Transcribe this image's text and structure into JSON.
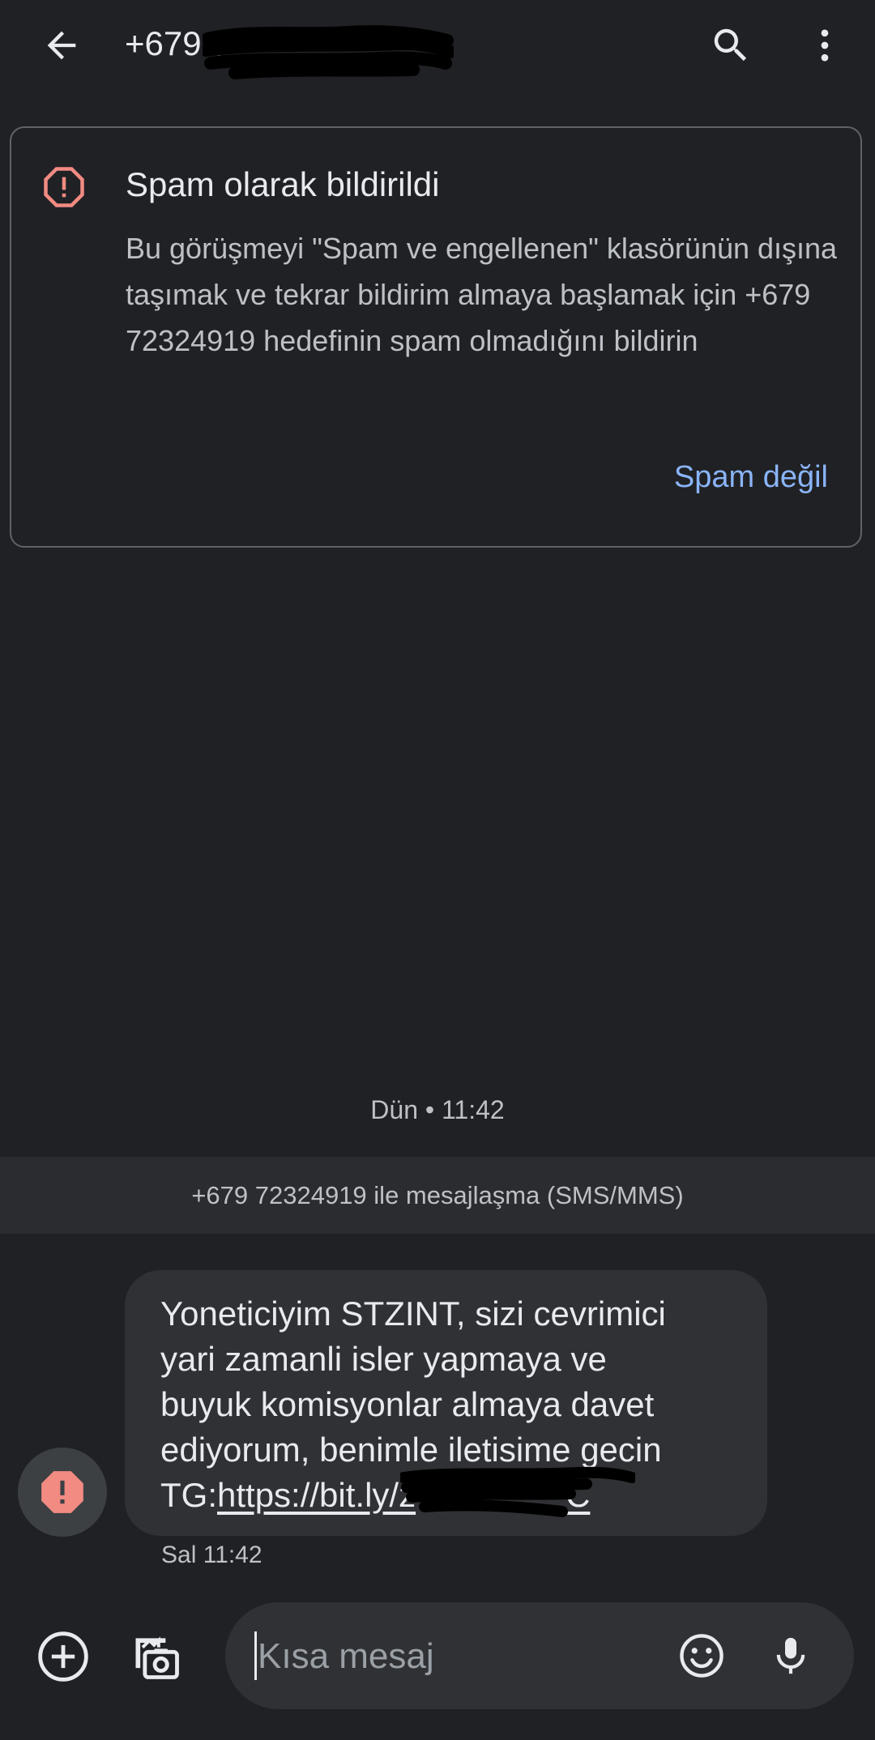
{
  "header": {
    "title": "+679 7",
    "back_icon": "arrow-back-icon",
    "search_icon": "search-icon",
    "menu_icon": "more-vert-icon"
  },
  "spam_card": {
    "icon": "warning-octagon-icon",
    "title": "Spam olarak bildirildi",
    "body": "Bu görüşmeyi \"Spam ve engellenen\" klasörünün dışına taşımak ve tekrar bildirim almaya başlamak için +679 72324919 hedefinin spam olmadığını bildirin",
    "action_label": "Spam değil"
  },
  "conversation": {
    "date_divider": "Dün • 11:42",
    "sms_banner": "+679 72324919 ile mesajlaşma (SMS/MMS)",
    "messages": [
      {
        "text": "Yoneticiyim STZINT, sizi cevrimici\nyari zamanli isler yapmaya ve\nbuyuk komisyonlar almaya davet\nediyorum, benimle iletisime gecin\nTG:",
        "link": "https://bit.ly/z",
        "link_suffix": "C",
        "time": "Sal 11:42",
        "status_icon": "error-icon"
      }
    ]
  },
  "compose": {
    "placeholder": "Kısa mesaj",
    "add_icon": "add-circle-icon",
    "gallery_icon": "gallery-camera-icon",
    "emoji_icon": "emoji-icon",
    "mic_icon": "mic-icon"
  },
  "colors": {
    "background": "#202124",
    "accent_link": "#8ab4f8",
    "warning": "#f28b82",
    "bubble": "#303134"
  }
}
